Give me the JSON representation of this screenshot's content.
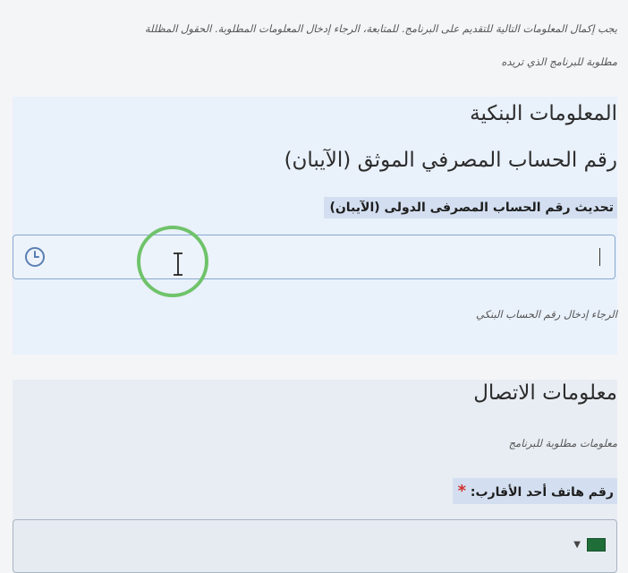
{
  "intro": {
    "line1": "يجب إكمال المعلومات التالية للتقديم على البرنامج. للمتابعة، الرجاء إدخال المعلومات المطلوبة. الحقول المظللة",
    "line2": "مطلوبة للبرنامج الذي تريده"
  },
  "bank": {
    "title": "المعلومات البنكية",
    "subtitle": "رقم الحساب المصرفي الموثق (الآيبان)",
    "field_label": "تحديث رقم الحساب المصرفى الدولى (الآيبان)",
    "field_value": "",
    "hint": "الرجاء إدخال رقم الحساب البنكي"
  },
  "contact": {
    "title": "معلومات الاتصال",
    "note": "معلومات مطلوبة للبرنامج",
    "phone_label": "رقم هاتف أحد الأقارب:",
    "required_mark": "*"
  },
  "icons": {
    "clock": "clock-icon",
    "flag": "saudi-flag-icon",
    "dropdown": "chevron-down-icon",
    "pointer": "text-cursor-icon"
  },
  "colors": {
    "card_bg": "#e9f1fb",
    "input_border": "#88a7cf",
    "required": "#d0322d",
    "cursor_ring": "#6fc36a"
  }
}
